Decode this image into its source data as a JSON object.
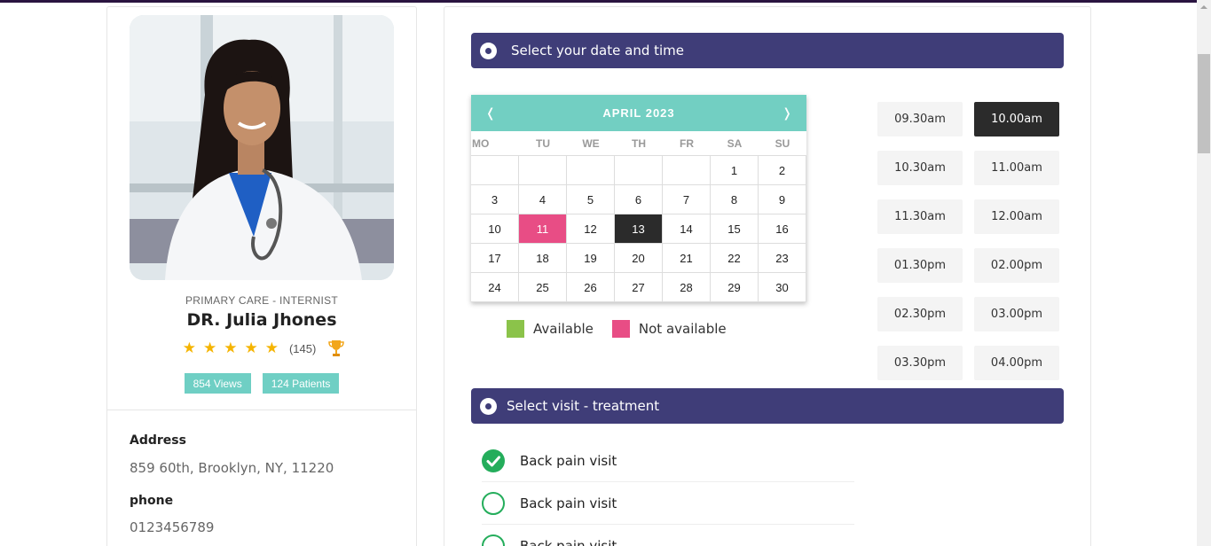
{
  "doctor": {
    "specialty": "PRIMARY CARE - INTERNIST",
    "name": "DR. Julia Jhones",
    "rating_stars": 5,
    "rating_count": "(145)",
    "views_badge": "854 Views",
    "patients_badge": "124 Patients",
    "address_label": "Address",
    "address": "859 60th, Brooklyn, NY, 11220",
    "phone_label": "phone",
    "phone": "0123456789"
  },
  "booking": {
    "date_section_title": "Select your date and time",
    "treatment_section_title": "Select visit - treatment",
    "calendar": {
      "month": "APRIL 2023",
      "prev": "❬",
      "next": "❭",
      "weekdays": [
        "MO",
        "TU",
        "WE",
        "TH",
        "FR",
        "SA",
        "SU"
      ],
      "weeks": [
        [
          "",
          "",
          "",
          "",
          "",
          "1",
          "2"
        ],
        [
          "3",
          "4",
          "5",
          "6",
          "7",
          "8",
          "9"
        ],
        [
          "10",
          "11",
          "12",
          "13",
          "14",
          "15",
          "16"
        ],
        [
          "17",
          "18",
          "19",
          "20",
          "21",
          "22",
          "23"
        ],
        [
          "24",
          "25",
          "26",
          "27",
          "28",
          "29",
          "30"
        ]
      ],
      "not_available_day": "11",
      "selected_day": "13"
    },
    "legend": {
      "available": "Available",
      "not_available": "Not available",
      "available_color": "#8bc34a",
      "not_available_color": "#e84d85"
    },
    "time_slots": [
      "09.30am",
      "10.00am",
      "10.30am",
      "11.00am",
      "11.30am",
      "12.00am",
      "01.30pm",
      "02.00pm",
      "02.30pm",
      "03.00pm",
      "03.30pm",
      "04.00pm"
    ],
    "selected_time": "10.00am",
    "treatments": [
      {
        "label": "Back pain visit",
        "checked": true
      },
      {
        "label": "Back pain visit",
        "checked": false
      },
      {
        "label": "Back pain visit",
        "checked": false
      }
    ]
  },
  "colors": {
    "section_bar": "#3f3d78",
    "accent_teal": "#72cfc2",
    "check_green": "#24ad5b",
    "star": "#f5b400"
  }
}
